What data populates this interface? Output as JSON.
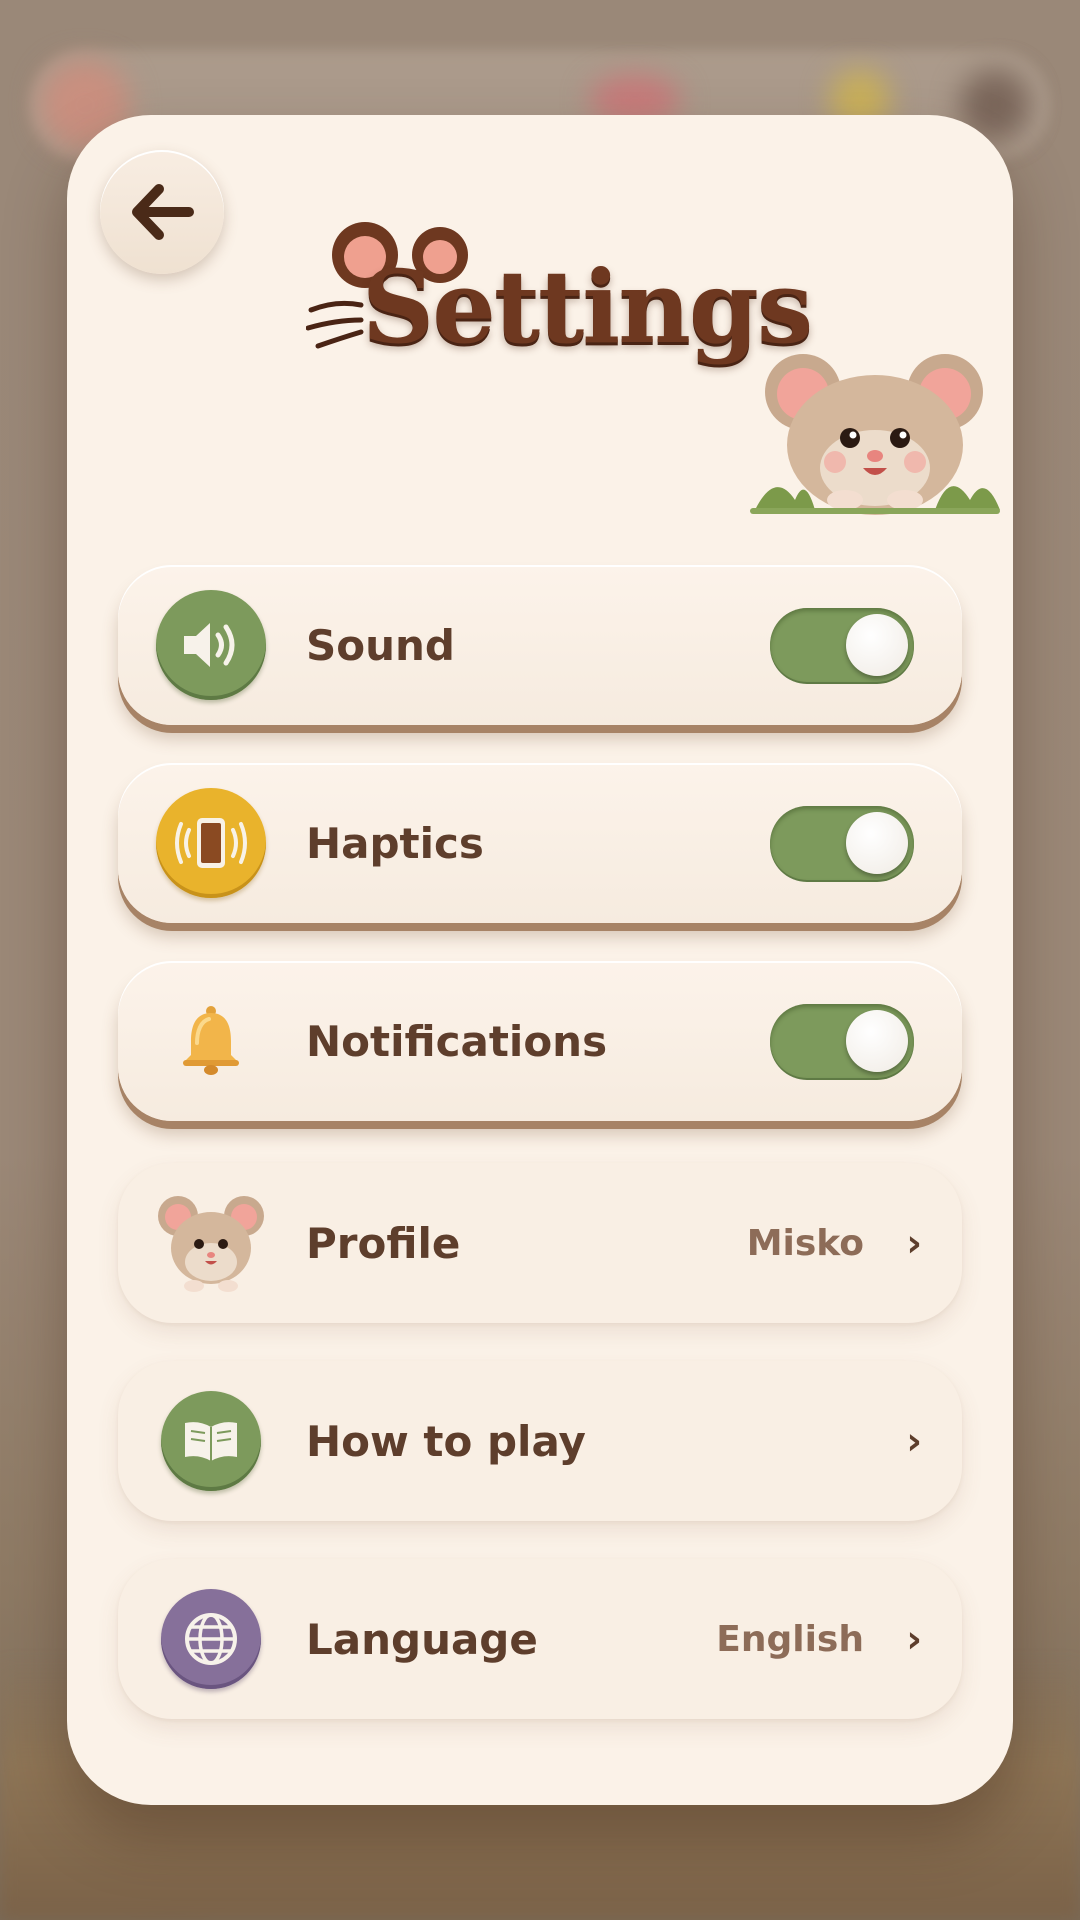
{
  "header": {
    "title": "Settings"
  },
  "rows": [
    {
      "label": "Sound",
      "type": "toggle",
      "on": true,
      "icon": "speaker-icon"
    },
    {
      "label": "Haptics",
      "type": "toggle",
      "on": true,
      "icon": "vibrate-phone-icon"
    },
    {
      "label": "Notifications",
      "type": "toggle",
      "on": true,
      "icon": "bell-icon"
    },
    {
      "label": "Profile",
      "type": "nav",
      "value": "Misko",
      "icon": "mouse-avatar-icon"
    },
    {
      "label": "How to play",
      "type": "nav",
      "value": "",
      "icon": "book-icon"
    },
    {
      "label": "Language",
      "type": "nav",
      "value": "English",
      "icon": "globe-icon"
    }
  ],
  "chevron": "›",
  "colors": {
    "card": "#fbf2e8",
    "text": "#5e3e2c",
    "toggle_on": "#7d9a5c",
    "sound_icon": "#7d9a5c",
    "haptics_icon": "#e9b32c",
    "book_icon": "#7d9a5c",
    "globe_icon": "#86709a"
  }
}
